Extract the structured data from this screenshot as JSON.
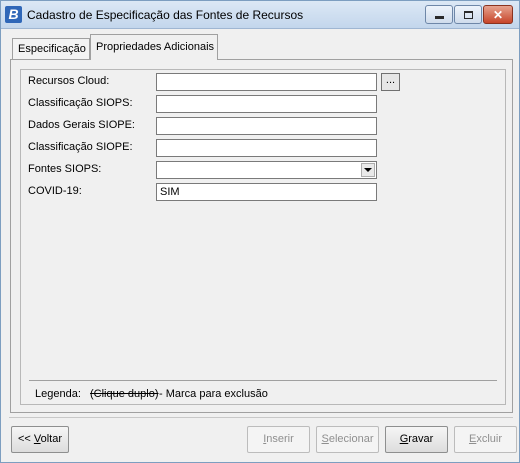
{
  "window": {
    "app_icon_letter": "B",
    "title": "Cadastro de Especificação das Fontes de Recursos"
  },
  "tabs": [
    {
      "label": "Especificação",
      "active": false
    },
    {
      "label": "Propriedades Adicionais",
      "active": true
    }
  ],
  "form": {
    "recursos_cloud": {
      "label": "Recursos Cloud:",
      "value": "",
      "button_label": "..."
    },
    "classificacao_siops": {
      "label": "Classificação SIOPS:",
      "value": ""
    },
    "dados_gerais_siope": {
      "label": "Dados Gerais SIOPE:",
      "value": ""
    },
    "classificacao_siope": {
      "label": "Classificação SIOPE:",
      "value": ""
    },
    "fontes_siops": {
      "label": "Fontes SIOPS:",
      "value": ""
    },
    "covid19": {
      "label": "COVID-19:",
      "value": "SIM"
    }
  },
  "legend": {
    "label": "Legenda:",
    "struck": "(Clique duplo)",
    "description": "- Marca para exclusão"
  },
  "buttons": {
    "voltar": {
      "prefix": "<< ",
      "mnemonic": "V",
      "rest": "oltar",
      "enabled": true
    },
    "inserir": {
      "mnemonic": "I",
      "rest": "nserir",
      "enabled": false
    },
    "selecionar": {
      "mnemonic": "S",
      "rest": "elecionar",
      "enabled": false
    },
    "gravar": {
      "mnemonic": "G",
      "rest": "ravar",
      "enabled": true
    },
    "excluir": {
      "mnemonic": "E",
      "rest": "xcluir",
      "enabled": false
    }
  },
  "colors": {
    "window_bg": "#f0f0f0",
    "title_bar": "#c3d6ec",
    "close_button": "#c7452a",
    "app_icon": "#2f67b8"
  },
  "icons": [
    "app-logo-icon",
    "minimize-icon",
    "maximize-icon",
    "close-icon",
    "dropdown-arrow-icon"
  ]
}
